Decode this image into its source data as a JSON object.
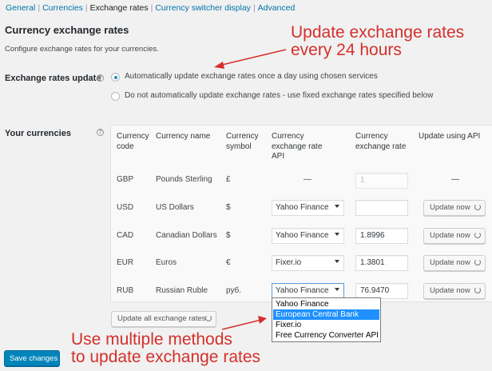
{
  "subnav": {
    "items": [
      {
        "label": "General",
        "current": false
      },
      {
        "label": "Currencies",
        "current": false
      },
      {
        "label": "Exchange rates",
        "current": true
      },
      {
        "label": "Currency switcher display",
        "current": false
      },
      {
        "label": "Advanced",
        "current": false
      }
    ]
  },
  "section": {
    "title": "Currency exchange rates",
    "description": "Configure exchange rates for your currencies."
  },
  "exchange_update": {
    "label": "Exchange rates update",
    "help_icon": "question-icon",
    "options": [
      {
        "label": "Automatically update exchange rates once a day using chosen services",
        "checked": true
      },
      {
        "label": "Do not automatically update exchange rates - use fixed exchange rates specified below",
        "checked": false
      }
    ]
  },
  "currencies": {
    "label": "Your currencies",
    "help_icon": "question-icon",
    "headers": {
      "code": "Currency code",
      "name": "Currency name",
      "symbol": "Currency symbol",
      "api": "Currency exchange rate API",
      "rate": "Currency exchange rate",
      "update": "Update using API"
    },
    "rows": [
      {
        "code": "GBP",
        "name": "Pounds Sterling",
        "symbol": "£",
        "api": "—",
        "rate": "",
        "rate_placeholder": "1",
        "update": "—"
      },
      {
        "code": "USD",
        "name": "US Dollars",
        "symbol": "$",
        "api": "Yahoo Finance",
        "rate": "",
        "update": "Update now"
      },
      {
        "code": "CAD",
        "name": "Canadian Dollars",
        "symbol": "$",
        "api": "Yahoo Finance",
        "rate": "1.8996",
        "update": "Update now"
      },
      {
        "code": "EUR",
        "name": "Euros",
        "symbol": "€",
        "api": "Fixer.io",
        "rate": "1.3801",
        "update": "Update now"
      },
      {
        "code": "RUB",
        "name": "Russian Ruble",
        "symbol": "руб.",
        "api": "Yahoo Finance",
        "rate": "76.9470",
        "update": "Update now"
      }
    ],
    "dropdown_options": [
      "Yahoo Finance",
      "European Central Bank",
      "Fixer.io",
      "Free Currency Converter API"
    ],
    "dropdown_highlighted": "European Central Bank",
    "update_all": "Update all exchange rates"
  },
  "save_button": "Save changes",
  "annotations": {
    "top_line1": "Update exchange rates",
    "top_line2": "every 24 hours",
    "bottom_line1": "Use multiple methods",
    "bottom_line2": "to update exchange rates",
    "color": "#d3302b"
  },
  "colors": {
    "link": "#0073aa",
    "primary": "#0085ba",
    "highlight": "#1e90ff"
  }
}
